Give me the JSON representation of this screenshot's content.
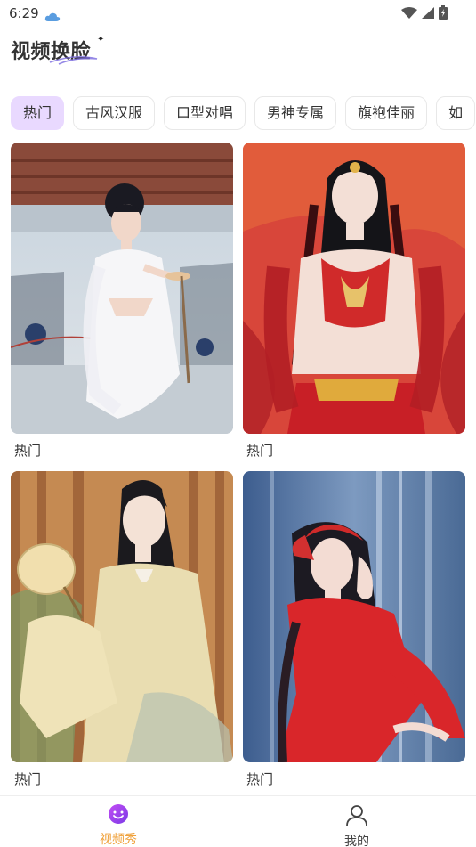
{
  "status": {
    "time": "6:29"
  },
  "header": {
    "title": "视频换脸"
  },
  "tabs": [
    {
      "label": "热门",
      "active": true
    },
    {
      "label": "古风汉服"
    },
    {
      "label": "口型对唱"
    },
    {
      "label": "男神专属"
    },
    {
      "label": "旗袍佳丽"
    },
    {
      "label": "如"
    }
  ],
  "cards": [
    {
      "label": "热门",
      "image": "woman-white-hanfu-dancing"
    },
    {
      "label": "热门",
      "image": "woman-red-exotic-costume"
    },
    {
      "label": "热门",
      "image": "woman-yellow-hanfu-fan"
    },
    {
      "label": "热门",
      "image": "woman-red-cloak-waterfall"
    }
  ],
  "bottom_nav": [
    {
      "label": "视频秀",
      "icon": "smiley-icon",
      "active": true
    },
    {
      "label": "我的",
      "icon": "person-icon",
      "active": false
    }
  ],
  "colors": {
    "accent": "#f0a23c",
    "tab_active_bg": "#e9d9ff",
    "icon_purple": "#a34cf0"
  }
}
